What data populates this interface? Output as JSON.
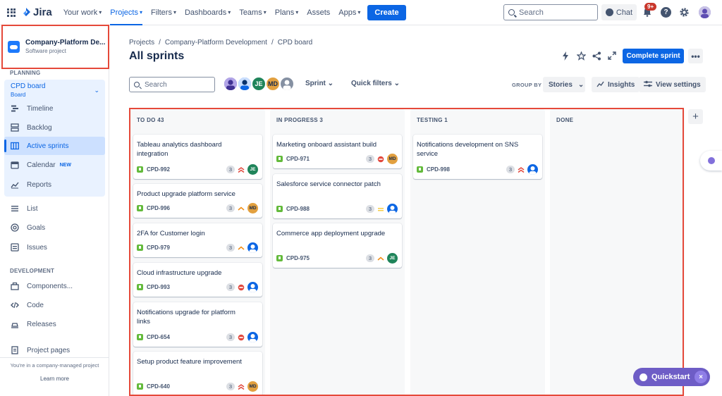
{
  "topnav": {
    "logo_text": "Jira",
    "items": [
      {
        "label": "Your work",
        "active": false
      },
      {
        "label": "Projects",
        "active": true
      },
      {
        "label": "Filters",
        "active": false
      },
      {
        "label": "Dashboards",
        "active": false
      },
      {
        "label": "Teams",
        "active": false
      },
      {
        "label": "Plans",
        "active": false
      },
      {
        "label": "Assets",
        "active": false
      },
      {
        "label": "Apps",
        "active": false
      }
    ],
    "create_label": "Create",
    "search_placeholder": "Search",
    "chat_label": "Chat",
    "notification_count": "9+",
    "help_glyph": "?"
  },
  "sidebar": {
    "project_name": "Company-Platform De...",
    "project_type": "Software project",
    "planning_label": "PLANNING",
    "board_name": "CPD board",
    "board_sub": "Board",
    "planning_items": [
      {
        "label": "Timeline",
        "icon": "timeline-icon"
      },
      {
        "label": "Backlog",
        "icon": "backlog-icon"
      },
      {
        "label": "Active sprints",
        "icon": "board-columns-icon",
        "active": true
      },
      {
        "label": "Calendar",
        "icon": "calendar-icon",
        "badge": "NEW"
      },
      {
        "label": "Reports",
        "icon": "reports-icon"
      }
    ],
    "other_items": [
      {
        "label": "List",
        "icon": "list-icon"
      },
      {
        "label": "Goals",
        "icon": "goals-icon"
      },
      {
        "label": "Issues",
        "icon": "issues-icon"
      }
    ],
    "development_label": "DEVELOPMENT",
    "development_items": [
      {
        "label": "Components...",
        "icon": "components-icon"
      },
      {
        "label": "Code",
        "icon": "code-icon"
      },
      {
        "label": "Releases",
        "icon": "releases-icon"
      }
    ],
    "project_pages": "Project pages",
    "footer_text": "You're in a company-managed project",
    "learn_more": "Learn more"
  },
  "header": {
    "breadcrumb": [
      "Projects",
      "Company-Platform Development",
      "CPD board"
    ],
    "title": "All sprints",
    "complete_sprint": "Complete sprint",
    "more_glyph": "•••"
  },
  "toolbar": {
    "search_placeholder": "Search",
    "avatar_initials": [
      "JE",
      "MD"
    ],
    "sprint_label": "Sprint",
    "quick_filters_label": "Quick filters",
    "group_by_label": "GROUP BY",
    "group_by_value": "Stories",
    "insights_label": "Insights",
    "view_settings_label": "View settings"
  },
  "board": {
    "columns": [
      {
        "header": "TO DO 43",
        "cards": [
          {
            "title": "Tableau analytics dashboard integration",
            "key": "CPD-992",
            "points": "3",
            "priority": "high",
            "assignee": "JE"
          },
          {
            "title": "Product upgrade platform service",
            "key": "CPD-996",
            "points": "3",
            "priority": "medium-high",
            "assignee": "MD"
          },
          {
            "title": "2FA for Customer login",
            "key": "CPD-979",
            "points": "3",
            "priority": "medium-high",
            "assignee": "person"
          },
          {
            "title": "Cloud infrastructure upgrade",
            "key": "CPD-993",
            "points": "3",
            "priority": "blocker",
            "assignee": "person"
          },
          {
            "title": "Notifications upgrade for platform links",
            "key": "CPD-654",
            "points": "3",
            "priority": "blocker",
            "assignee": "person"
          },
          {
            "title": "Setup product feature improvement",
            "key": "CPD-640",
            "points": "3",
            "priority": "high",
            "assignee": "MD"
          }
        ]
      },
      {
        "header": "IN PROGRESS 3",
        "cards": [
          {
            "title": "Marketing onboard assistant build",
            "key": "CPD-971",
            "points": "3",
            "priority": "blocker",
            "assignee": "MD"
          },
          {
            "title": "Salesforce service connector patch",
            "key": "CPD-988",
            "points": "3",
            "priority": "medium",
            "assignee": "person"
          },
          {
            "title": "Commerce app deployment upgrade",
            "key": "CPD-975",
            "points": "3",
            "priority": "medium-high",
            "assignee": "JE"
          }
        ]
      },
      {
        "header": "TESTING 1",
        "cards": [
          {
            "title": "Notifications development on SNS service",
            "key": "CPD-998",
            "points": "3",
            "priority": "high",
            "assignee": "person"
          }
        ]
      },
      {
        "header": "DONE",
        "cards": []
      }
    ]
  },
  "quickstart": {
    "label": "Quickstart",
    "close_glyph": "×"
  },
  "colors": {
    "accent": "#0c66e4",
    "highlight": "#e5493a",
    "quickstart": "#6e5dc6",
    "story": "#63ba3c"
  }
}
